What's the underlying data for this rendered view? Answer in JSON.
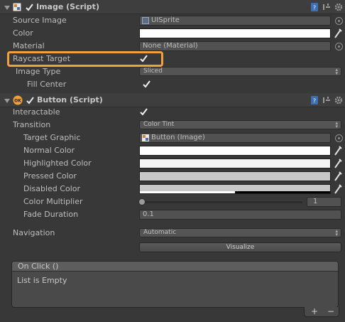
{
  "image_component": {
    "title": "Image (Script)",
    "rows": {
      "source_image_label": "Source Image",
      "source_image_value": "UISprite",
      "color_label": "Color",
      "material_label": "Material",
      "material_value": "None (Material)",
      "raycast_label": "Raycast Target",
      "raycast_checked": true,
      "image_type_label": "Image Type",
      "image_type_value": "Sliced",
      "fill_center_label": "Fill Center",
      "fill_center_checked": true
    },
    "color_value": "#ffffff"
  },
  "button_component": {
    "title": "Button (Script)",
    "ok_badge": "OK",
    "rows": {
      "interactable_label": "Interactable",
      "transition_label": "Transition",
      "transition_value": "Color Tint",
      "target_graphic_label": "Target Graphic",
      "target_graphic_value": "Button (Image)",
      "normal_color_label": "Normal Color",
      "highlighted_color_label": "Highlighted Color",
      "pressed_color_label": "Pressed Color",
      "disabled_color_label": "Disabled Color",
      "color_multiplier_label": "Color Multiplier",
      "color_multiplier_value": "1",
      "color_multiplier_level": 0.0,
      "fade_duration_label": "Fade Duration",
      "fade_duration_value": "0.1",
      "navigation_label": "Navigation",
      "navigation_value": "Automatic",
      "visualize_label": "Visualize"
    },
    "colors": {
      "normal": "#ffffff",
      "highlighted": "#f5f5f5",
      "pressed": "#c8c8c8",
      "disabled": "#c8c8c8"
    },
    "on_click": {
      "header": "On Click ()",
      "empty_text": "List is Empty",
      "add_label": "+",
      "remove_label": "−"
    }
  },
  "icons": [
    "fold-arrow-icon",
    "image-component-icon",
    "enabled-checkbox",
    "help-book-icon",
    "preset-icon",
    "gear-icon",
    "sprite-icon",
    "color-picker-icon",
    "object-picker-icon",
    "button-ok-icon",
    "checkmark-icon"
  ],
  "accent": {
    "highlight": "#f1a13a"
  }
}
